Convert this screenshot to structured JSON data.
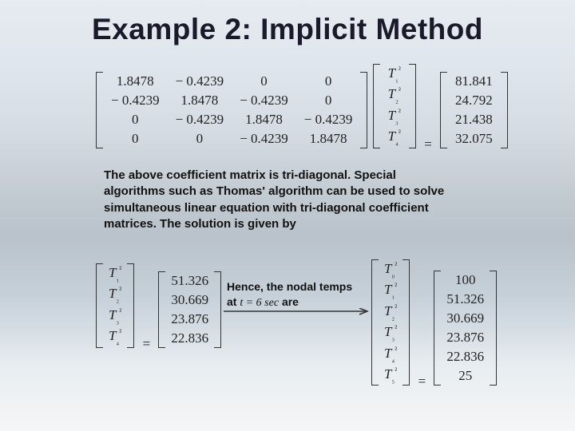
{
  "title": "Example 2: Implicit Method",
  "eq1": {
    "A": [
      [
        "1.8478",
        "− 0.4239",
        "0",
        "0"
      ],
      [
        "− 0.4239",
        "1.8478",
        "− 0.4239",
        "0"
      ],
      [
        "0",
        "− 0.4239",
        "1.8478",
        "− 0.4239"
      ],
      [
        "0",
        "0",
        "− 0.4239",
        "1.8478"
      ]
    ],
    "x": [
      "T₁²",
      "T₂²",
      "T₃²",
      "T₄²"
    ],
    "b": [
      "81.841",
      "24.792",
      "21.438",
      "32.075"
    ]
  },
  "para1": "The above coefficient matrix is tri-diagonal. Special algorithms such as Thomas' algorithm can be used to solve simultaneous linear equation with tri-diagonal coefficient matrices. The solution is given by",
  "eq2": {
    "x": [
      "T₁²",
      "T₂²",
      "T₃²",
      "T₄²"
    ],
    "b": [
      "51.326",
      "30.669",
      "23.876",
      "22.836"
    ]
  },
  "nodal_text_prefix": "Hence, the nodal temps at ",
  "t_equals": "t = 6 sec",
  "nodal_text_suffix": " are",
  "eq3": {
    "x": [
      "T₀²",
      "T₁²",
      "T₂²",
      "T₃²",
      "T₄²",
      "T₅²"
    ],
    "b": [
      "100",
      "51.326",
      "30.669",
      "23.876",
      "22.836",
      "25"
    ]
  }
}
